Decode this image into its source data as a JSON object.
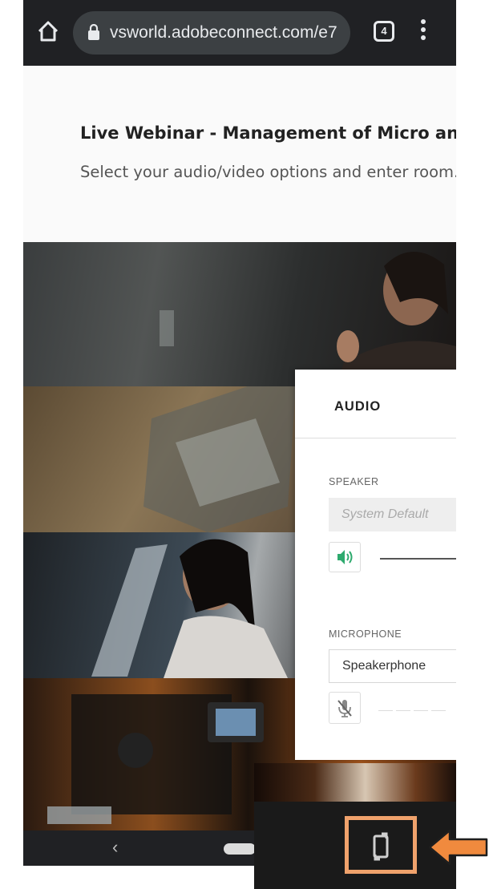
{
  "browser": {
    "url": "vsworld.adobeconnect.com/e7",
    "tab_count": "4"
  },
  "page": {
    "title": "Live Webinar - Management of Micro and Macr",
    "subtitle": "Select your audio/video options and enter room."
  },
  "audio_panel": {
    "title": "AUDIO",
    "speaker": {
      "label": "SPEAKER",
      "placeholder": "System Default"
    },
    "microphone": {
      "label": "MICROPHONE",
      "selected": "Speakerphone"
    }
  },
  "icons": {
    "home": "home-icon",
    "lock": "lock-icon",
    "tabs": "tab-switcher-icon",
    "menu": "more-vert-icon",
    "speaker": "speaker-volume-icon",
    "mic_muted": "microphone-muted-icon",
    "rotate": "screen-rotate-icon",
    "back": "chevron-left-icon"
  },
  "colors": {
    "chrome_bar": "#202124",
    "speaker_icon": "#2eaa6e",
    "highlight": "#f0a26c",
    "arrow": "#f08a3e"
  }
}
